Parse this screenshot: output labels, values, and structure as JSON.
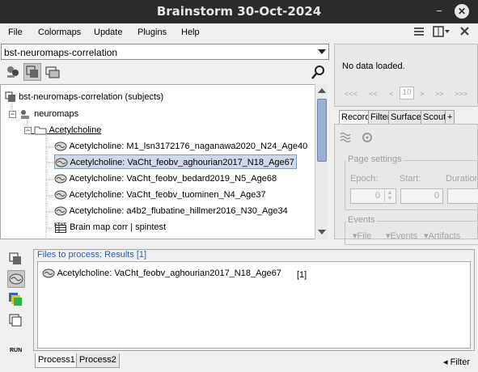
{
  "window": {
    "title": "Brainstorm 30-Oct-2024"
  },
  "menu": {
    "items": [
      "File",
      "Colormaps",
      "Update",
      "Plugins",
      "Help"
    ]
  },
  "protocol": {
    "selected": "bst-neuromaps-correlation"
  },
  "tree": {
    "root": "bst-neuromaps-correlation (subjects)",
    "subject": "neuromaps",
    "condition": "Acetylcholine",
    "files": [
      {
        "label": "Acetylcholine: M1_lsn3172176_naganawa2020_N24_Age40",
        "selected": false
      },
      {
        "label": "Acetylcholine: VaCht_feobv_aghourian2017_N18_Age67",
        "selected": true
      },
      {
        "label": "Acetylcholine: VaCht_feobv_bedard2019_N5_Age68",
        "selected": false
      },
      {
        "label": "Acetylcholine: VaCht_feobv_tuominen_N4_Age37",
        "selected": false
      },
      {
        "label": "Acetylcholine: a4b2_flubatine_hillmer2016_N30_Age34",
        "selected": false
      }
    ],
    "stat_file": "Brain map corr | spintest",
    "stat_badge": "STAT"
  },
  "right_panel": {
    "no_data": "No data loaded.",
    "nav": {
      "first": "<<<",
      "prev2": "<<",
      "prev": "<",
      "field": "10",
      "next": ">",
      "next2": ">>",
      "last": ">>>"
    },
    "tabs": [
      "Record",
      "Filter",
      "Surface",
      "Scout",
      "+"
    ],
    "page_settings": {
      "label": "Page settings",
      "epoch_label": "Epoch:",
      "start_label": "Start:",
      "duration_label": "Duration",
      "epoch_value": "0",
      "start_value": "0"
    },
    "events": {
      "label": "Events",
      "file": "File",
      "events": "Events",
      "artifacts": "Artifacts"
    }
  },
  "process": {
    "header": "Files to process: Results [1]",
    "files": [
      {
        "label": "Acetylcholine: VaCht_feobv_aghourian2017_N18_Age67",
        "count": "[1]"
      }
    ],
    "tabs": [
      "Process1",
      "Process2"
    ],
    "filter_label": "Filter",
    "run_label": "RUN"
  },
  "colors": {
    "selection": "#cfd9e9",
    "header_link": "#2b5fb0",
    "titlebar": "#2b2b2b"
  }
}
